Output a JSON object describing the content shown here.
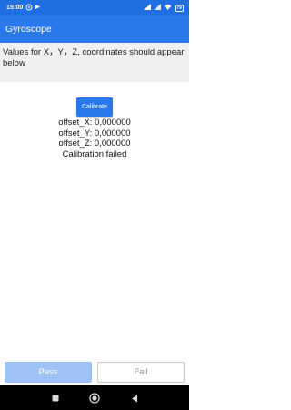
{
  "status_bar": {
    "time": "15:00",
    "battery": "79",
    "icons": [
      "whatsapp-icon",
      "media-icon",
      "signal-icon",
      "signal-icon",
      "wifi-icon",
      "battery-icon"
    ]
  },
  "app_bar": {
    "title": "Gyroscope"
  },
  "main": {
    "description": "Values for X，Y，Z, coordinates should appear below",
    "calibrate_label": "Calibrate",
    "offset_x": "offset_X: 0,000000",
    "offset_y": "offset_Y: 0,000000",
    "offset_z": "offset_Z: 0,000000",
    "status": "Calibration failed"
  },
  "footer": {
    "pass_label": "Pass",
    "fail_label": "Fail"
  },
  "nav": {
    "icons": [
      "recents-icon",
      "home-icon",
      "back-icon"
    ]
  },
  "colors": {
    "status_bar": "#1f6fe2",
    "app_bar": "#2a79ec",
    "description_bg": "#f0f0f0",
    "pass_disabled": "#9ec1f6",
    "nav_bar": "#000000"
  }
}
